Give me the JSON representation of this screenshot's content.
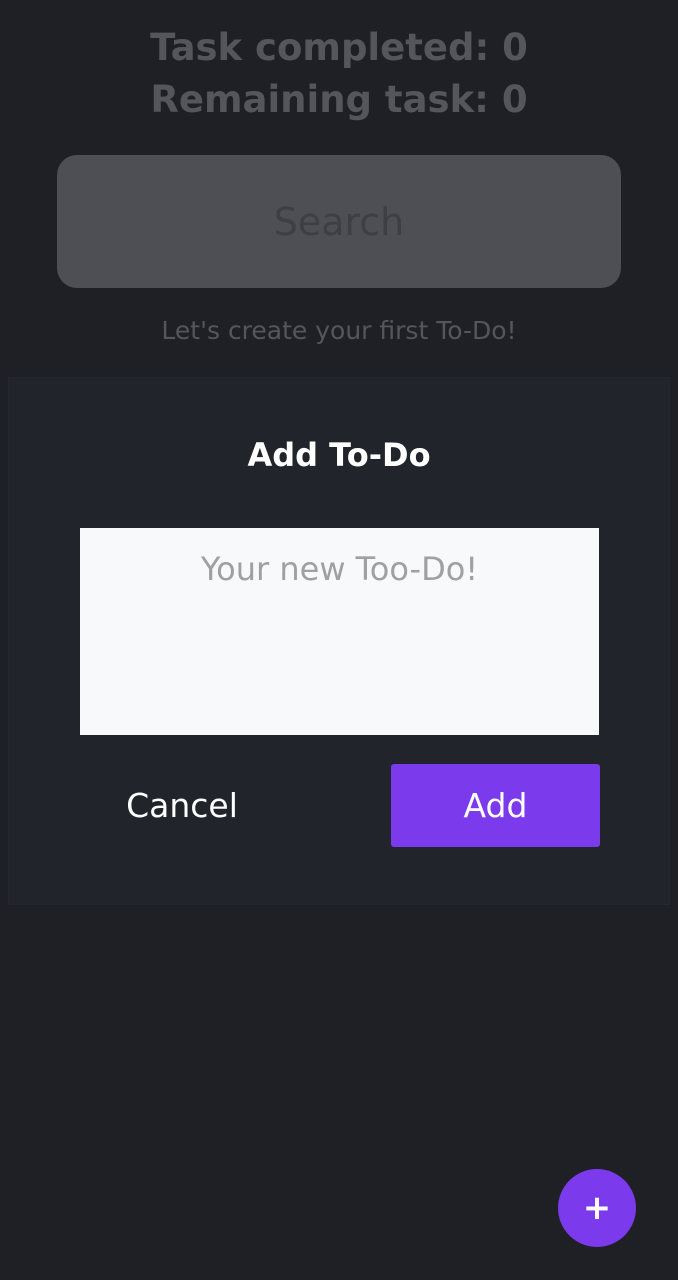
{
  "stats": {
    "completed": "Task completed: 0",
    "remaining": "Remaining task: 0"
  },
  "search": {
    "placeholder": "Search",
    "value": ""
  },
  "empty_hint": "Let's create your first To-Do!",
  "dialog": {
    "title": "Add To-Do",
    "input_placeholder": "Your new Too-Do!",
    "input_value": "",
    "cancel_label": "Cancel",
    "add_label": "Add"
  },
  "fab": {
    "label": "+",
    "icon": "plus-icon"
  },
  "colors": {
    "background": "#1f2025",
    "dialog": "#22242b",
    "accent": "#7c3aed",
    "muted_text": "#55565b",
    "search_bg": "#4e4f55"
  }
}
